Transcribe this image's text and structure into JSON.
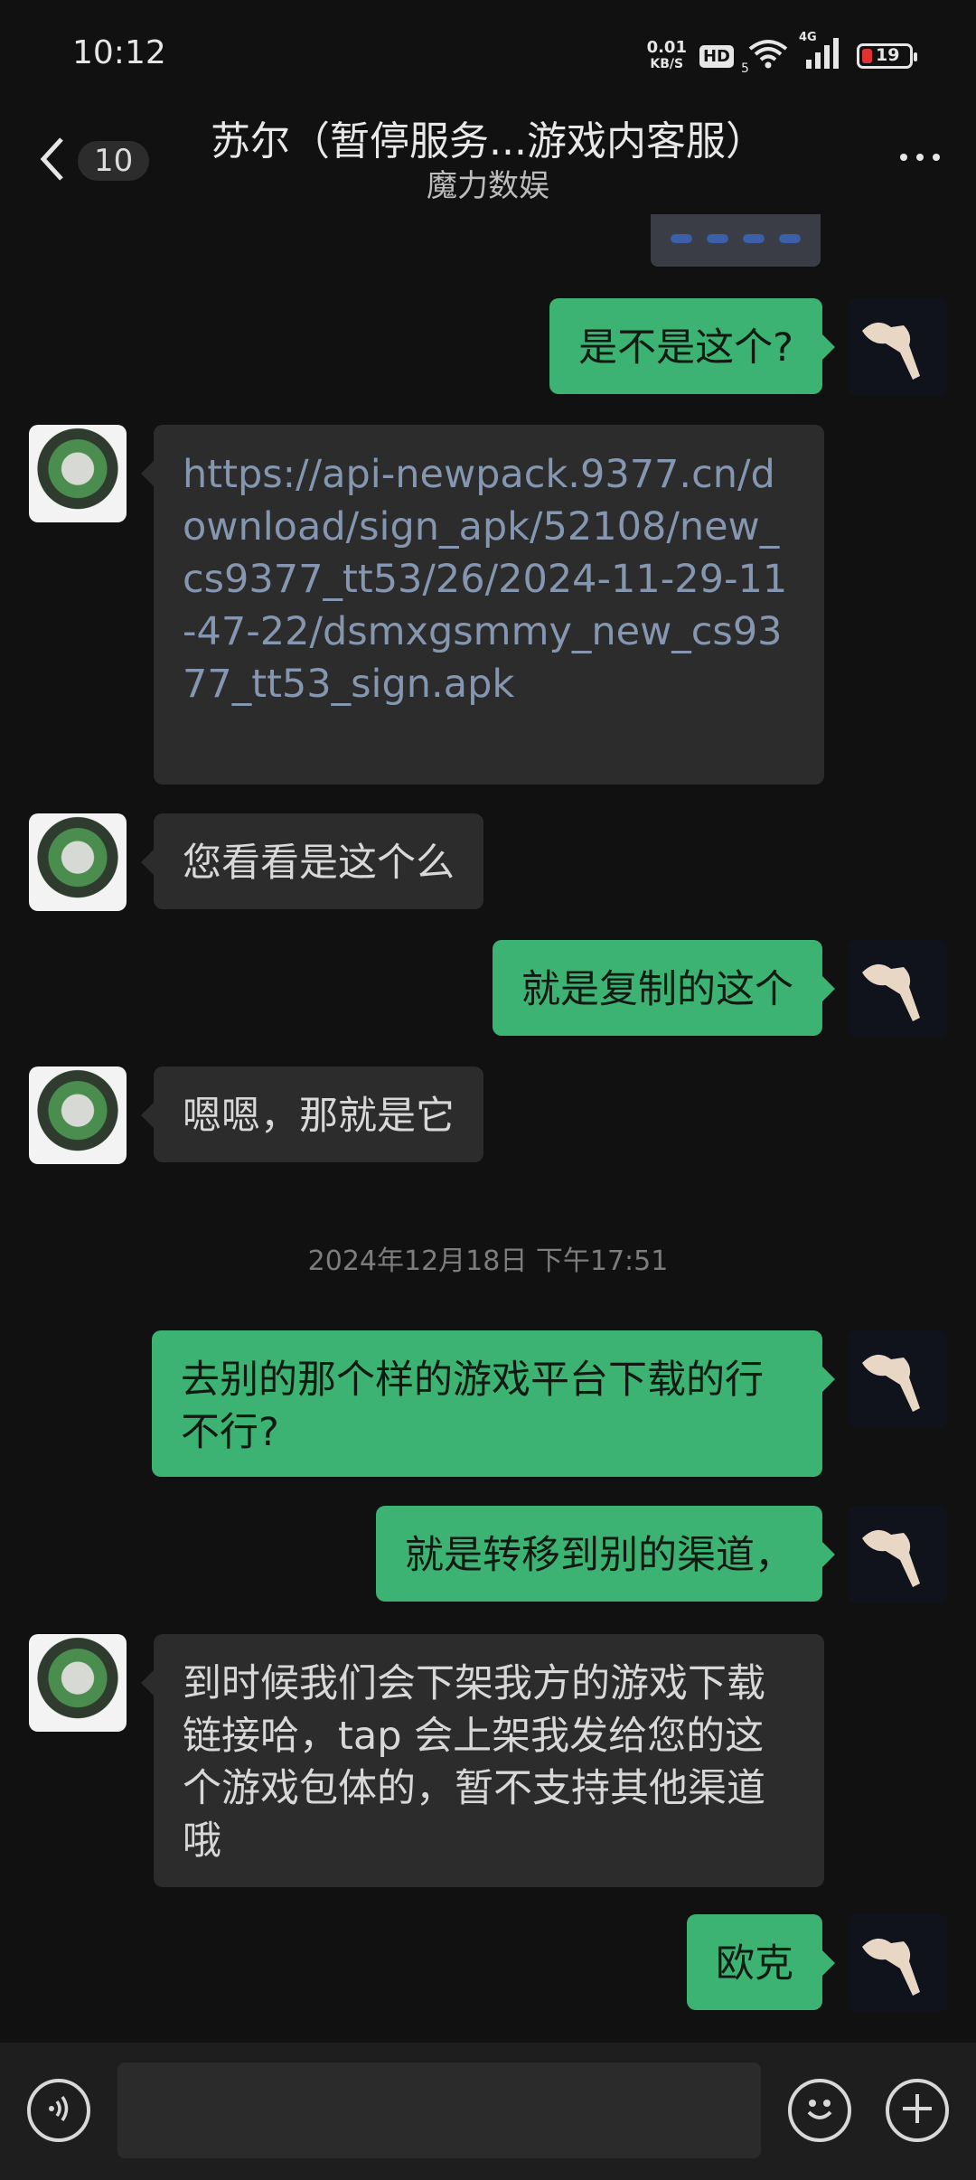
{
  "status_bar": {
    "time": "10:12",
    "net_speed_value": "0.01",
    "net_speed_unit": "KB/S",
    "hd_label": "HD",
    "network_type": "4G",
    "wifi_level": "5",
    "battery_level": "19"
  },
  "header": {
    "unread_count": "10",
    "title": "苏尔（暂停服务...游戏内客服）",
    "subtitle": "魔力数娱"
  },
  "messages": [
    {
      "sender": "me",
      "text": "是不是这个?"
    },
    {
      "sender": "other",
      "text": "https://api-newpack.9377.cn/download/sign_apk/52108/new_cs9377_tt53/26/2024-11-29-11-47-22/dsmxgsmmy_new_cs9377_tt53_sign.apk",
      "is_link": true
    },
    {
      "sender": "other",
      "text": "您看看是这个么"
    },
    {
      "sender": "me",
      "text": "就是复制的这个"
    },
    {
      "sender": "other",
      "text": "嗯嗯，那就是它"
    },
    {
      "sender": "me",
      "text": "去别的那个样的游戏平台下载的行不行?"
    },
    {
      "sender": "me",
      "text": "就是转移到别的渠道，"
    },
    {
      "sender": "other",
      "text": "到时候我们会下架我方的游戏下载链接哈，tap 会上架我发给您的这个游戏包体的，暂不支持其他渠道哦"
    },
    {
      "sender": "me",
      "text": "欧克"
    }
  ],
  "timestamp": "2024年12月18日 下午17:51",
  "colors": {
    "background": "#111111",
    "my_bubble": "#3db373",
    "other_bubble": "#2c2c2c",
    "link_text": "#8596b0",
    "battery_low": "#e03232"
  }
}
